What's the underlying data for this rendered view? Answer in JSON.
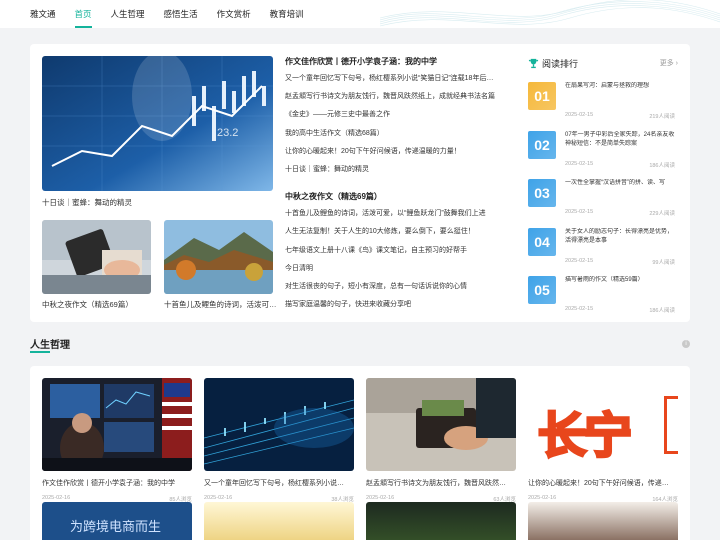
{
  "nav": {
    "brand": "雅文通",
    "items": [
      "首页",
      "人生哲理",
      "感悟生活",
      "作文赏析",
      "教育培训"
    ]
  },
  "top": {
    "big_caption": "十日谈｜蜜蜂：舞动的精灵",
    "small_captions": [
      "中秋之夜作文（精选69篇）",
      "十首鱼儿及鲤鱼的诗词，活泼可…"
    ],
    "sections": [
      {
        "title": "作文佳作欣赏丨德开小学袁子涵：我的中学",
        "lines": [
          "又一个童年回忆写下句号，杨红樱系列小说“笑猫日记”连载18年后…",
          "赵孟頫写行书诗文为朋友饯行，魏晋风趺然纸上，成就经典书法名篇",
          "《金史》——元修三史中最善之作",
          "我的高中生活作文（精选68篇）",
          "让你的心暖起来！20句下午好问候语，传递温暖的力量！",
          "十日谈｜蜜蜂：舞动的精灵"
        ]
      },
      {
        "title": "中秋之夜作文（精选69篇）",
        "lines": [
          "十首鱼儿及鲤鱼的诗词，活泼可爱，以“鲤鱼跃龙门”鼓舞我们上进",
          "人生无法复制！关于人生的10大修炼，要么倒下，要么挺住！",
          "七年级语文上册十八课《鸟》课文笔记，自主预习的好帮手",
          "今日清明",
          "对生活很丧的句子，短小有深度，总有一句话诉说你的心情",
          "描写家庭温馨的句子，快进来收藏分享吧"
        ]
      }
    ]
  },
  "ranking": {
    "title": "阅读排行",
    "more": "更多",
    "items": [
      {
        "num": "01",
        "text": "在扇果写河：启蒙与拯救的理想",
        "date": "2025-02-15",
        "reads": "219人阅读",
        "color": "#f5b83a"
      },
      {
        "num": "02",
        "text": "07年一男子中彩后全家失踪，24名亲友收神秘短信：不是简单失踪案",
        "date": "2025-02-15",
        "reads": "186人阅读",
        "color": "#3fa3e8"
      },
      {
        "num": "03",
        "text": "一次性全掌握“汉语拼音”的拼、读、写",
        "date": "2025-02-15",
        "reads": "229人阅读",
        "color": "#3fa3e8"
      },
      {
        "num": "04",
        "text": "关于女人的励志句子：长得漂亮是优势，活得漂亮是本事",
        "date": "2025-02-15",
        "reads": "99人阅读",
        "color": "#3fa3e8"
      },
      {
        "num": "05",
        "text": "描写暑雨的作文（精选59篇）",
        "date": "2025-02-15",
        "reads": "186人阅读",
        "color": "#3fa3e8"
      }
    ]
  },
  "section2": {
    "title": "人生哲理",
    "items": [
      {
        "caption": "作文佳作欣赏丨德开小学袁子涵：我的中学",
        "date": "2025-02-16",
        "views": "85人浏览"
      },
      {
        "caption": "又一个童年回忆写下句号，杨红樱系列小说…",
        "date": "2025-02-16",
        "views": "38人浏览"
      },
      {
        "caption": "赵孟頫写行书诗文为朋友饯行，魏晋风趺然…",
        "date": "2025-02-16",
        "views": "63人浏览"
      },
      {
        "caption": "让你的心暖起来！20句下午好问候语，传递…",
        "date": "2025-02-16",
        "views": "164人浏览"
      }
    ],
    "img4_text": "长宁",
    "row2_text": "为跨境电商而生"
  }
}
